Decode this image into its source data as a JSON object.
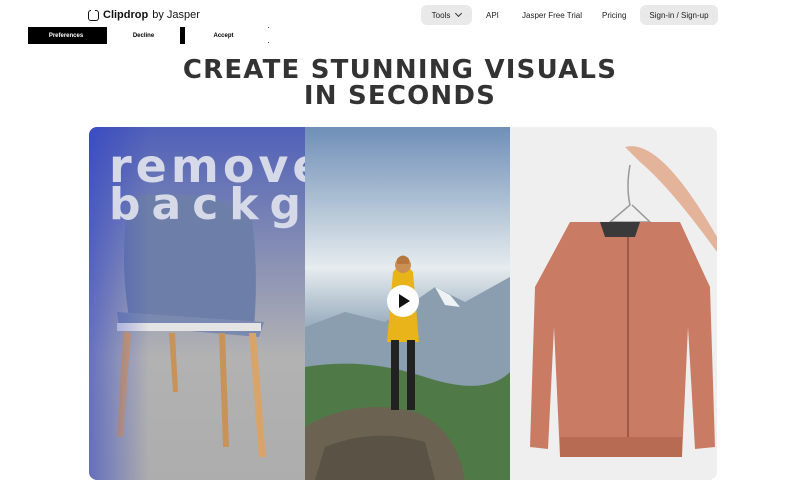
{
  "header": {
    "logo": {
      "name": "Clipdrop",
      "suffix": "by Jasper"
    },
    "nav": {
      "tools": "Tools",
      "api": "API",
      "trial": "Jasper Free Trial",
      "pricing": "Pricing",
      "signin": "Sign-in / Sign-up"
    }
  },
  "cookie": {
    "preferences": "Preferences",
    "decline": "Decline",
    "accept": "Accept"
  },
  "hero": {
    "headline_line1": "CREATE STUNNING VISUALS",
    "headline_line2": "IN SECONDS",
    "video_text_line1": "remove",
    "video_text_line2": "background"
  },
  "icons": {
    "logo": "clipdrop-logo-icon",
    "tools_dropdown": "chevron-down-icon",
    "play": "play-icon"
  },
  "colors": {
    "nav_pill": "#e9e9e9",
    "headline": "#333333",
    "cookie_primary": "#000000"
  }
}
